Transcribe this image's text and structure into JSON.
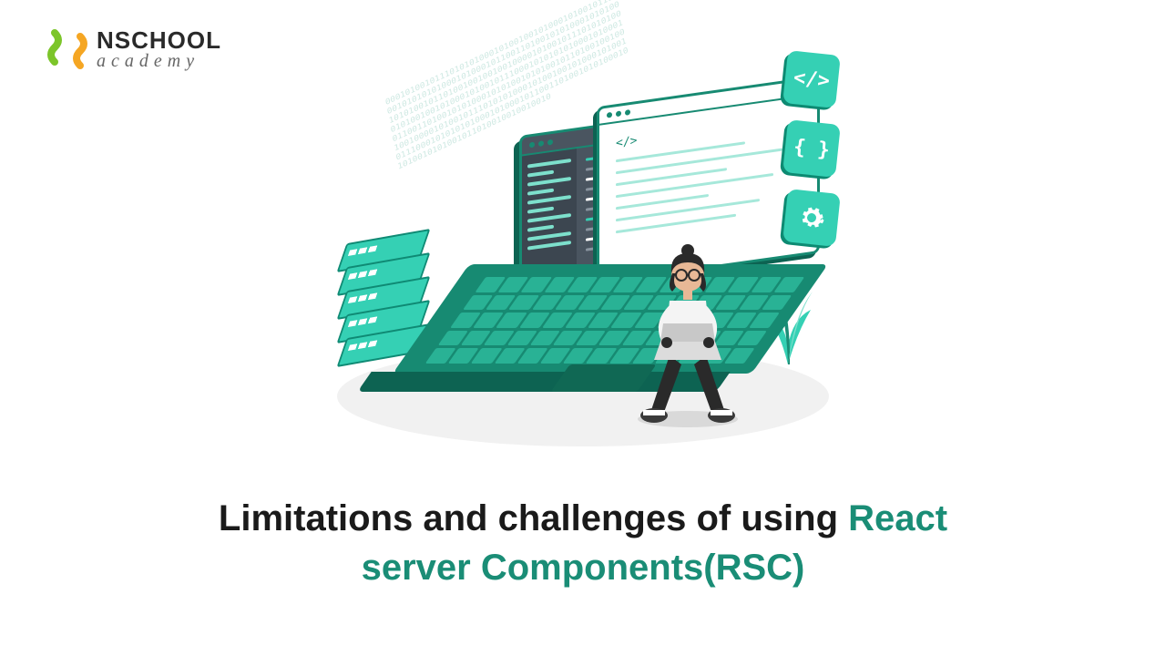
{
  "logo": {
    "line1": "NSCHOOL",
    "line2": "academy"
  },
  "headline": {
    "part1": "Limitations and challenges of using ",
    "accent1": "React",
    "part2": "server Components(RSC)"
  },
  "binary_fill": "000101001011101010100010100100101000101001011100010101010100010100010110011010010101000101010010101001011010010010010010000101001011101010100010100100101000101001011100010101010100010100010110011010010101000101010010101001011010010010010010000101001011101010100010100100101000101001011100010101010100010100010110011010010101000101010010101001011010010010010010",
  "badges": [
    "</>",
    "{ }",
    "gear"
  ]
}
